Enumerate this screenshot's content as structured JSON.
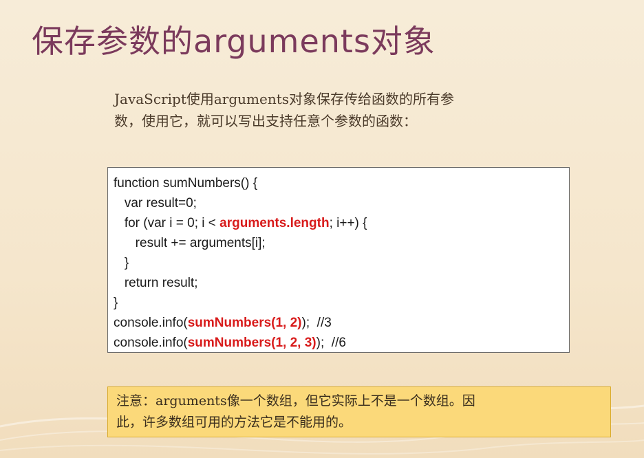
{
  "title": "保存参数的arguments对象",
  "intro": {
    "line1": "JavaScript使用arguments对象保存传给函数的所有参",
    "line2": "数，使用它，就可以写出支持任意个参数的函数："
  },
  "code": {
    "line1": "function sumNumbers() {",
    "line2": "   var result=0;",
    "line3_pre": "   for (var i = 0; i < ",
    "line3_hl": "arguments.length",
    "line3_post": "; i++) {",
    "line4": "      result += arguments[i];",
    "line5": "   }",
    "line6": "   return result;",
    "line7": "}",
    "line8_pre": "console.info(",
    "line8_hl": "sumNumbers(1, 2)",
    "line8_post": ");  //3",
    "line9_pre": "console.info(",
    "line9_hl": "sumNumbers(1, 2, 3)",
    "line9_post": ");  //6"
  },
  "note": {
    "line1": "注意：arguments像一个数组，但它实际上不是一个数组。因",
    "line2": "此，许多数组可用的方法它是不能用的。"
  },
  "colors": {
    "title": "#7b3a5c",
    "highlight": "#d81b1b",
    "note_bg": "#fbd97a",
    "background": "#f7ecd8"
  }
}
